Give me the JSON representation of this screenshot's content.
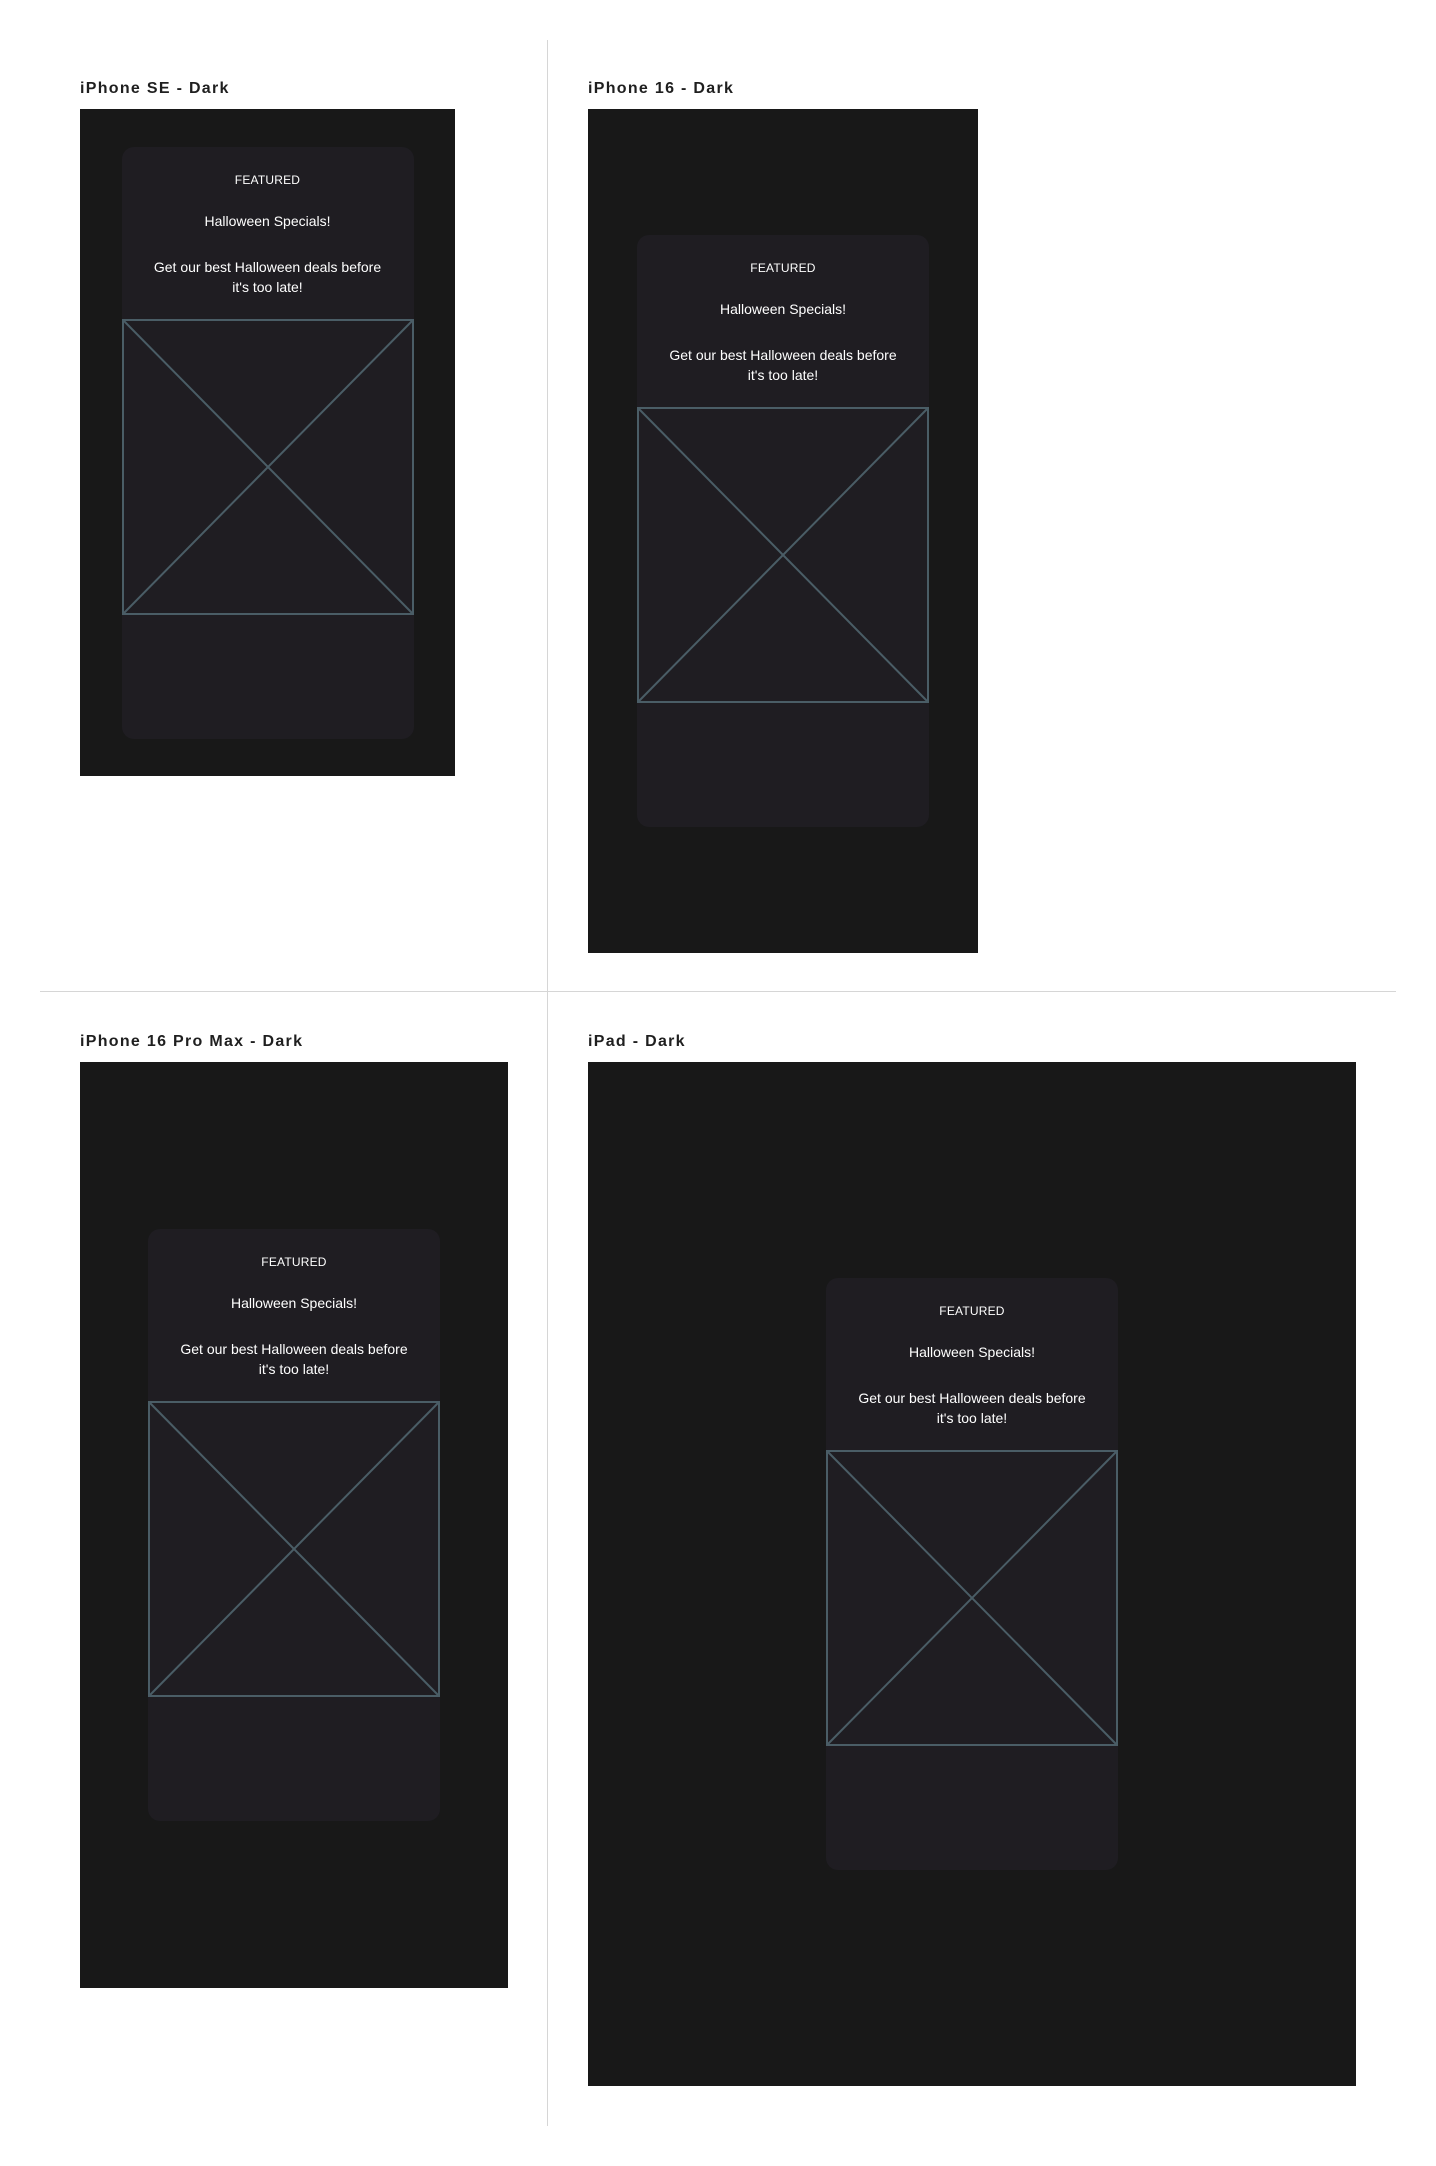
{
  "frames": [
    {
      "label": "iPhone SE - Dark"
    },
    {
      "label": "iPhone 16 - Dark"
    },
    {
      "label": "iPhone 16 Pro Max - Dark"
    },
    {
      "label": "iPad - Dark"
    }
  ],
  "card": {
    "eyebrow": "FEATURED",
    "title": "Halloween Specials!",
    "body": "Get our best Halloween deals before it's too late!",
    "image_icon": "image-placeholder-icon"
  },
  "colors": {
    "canvas": "#ffffff",
    "device_background": "#181818",
    "card_background": "#1f1d22",
    "placeholder_stroke": "#4a5d66",
    "text": "#ffffff",
    "label_text": "#1f1f1f"
  }
}
